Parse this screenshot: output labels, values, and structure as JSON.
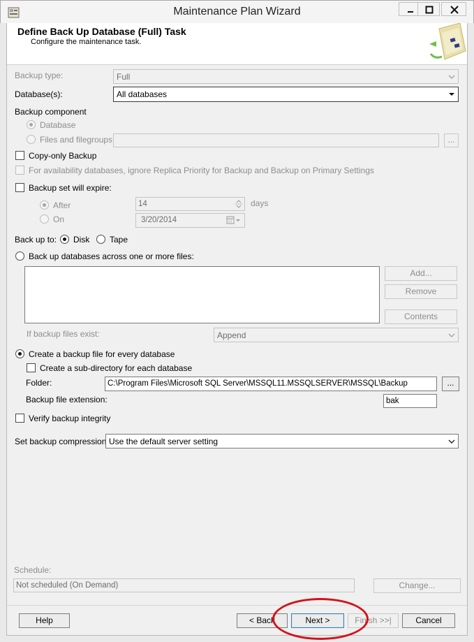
{
  "window": {
    "title": "Maintenance Plan Wizard"
  },
  "header": {
    "title": "Define Back Up Database (Full) Task",
    "subtitle": "Configure the maintenance task."
  },
  "form": {
    "backup_type": {
      "label": "Backup type:",
      "value": "Full"
    },
    "databases": {
      "label": "Database(s):",
      "value": "All databases"
    },
    "backup_component": {
      "label": "Backup component",
      "database_label": "Database",
      "files_label": "Files and filegroups:",
      "files_button": "...",
      "selected": "Database"
    },
    "copy_only": {
      "label": "Copy-only Backup",
      "checked": false
    },
    "availability": {
      "label": "For availability databases, ignore Replica Priority for Backup and Backup on Primary Settings",
      "checked": false
    },
    "expire": {
      "label": "Backup set will expire:",
      "checked": false,
      "after_label": "After",
      "after_value": "14",
      "days_label": "days",
      "on_label": "On",
      "on_value": "3/20/2014",
      "selected": "After"
    },
    "back_up_to": {
      "label": "Back up to:",
      "disk_label": "Disk",
      "tape_label": "Tape",
      "selected": "Disk"
    },
    "across_files": {
      "label": "Back up databases across one or more files:",
      "add_button": "Add...",
      "remove_button": "Remove",
      "contents_button": "Contents",
      "exists_label": "If backup files exist:",
      "exists_value": "Append"
    },
    "every_db": {
      "label": "Create a backup file for every database",
      "subdir_label": "Create a sub-directory for each database",
      "subdir_checked": false,
      "folder_label": "Folder:",
      "folder_value": "C:\\Program Files\\Microsoft SQL Server\\MSSQL11.MSSQLSERVER\\MSSQL\\Backup",
      "folder_button": "...",
      "ext_label": "Backup file extension:",
      "ext_value": "bak"
    },
    "verify": {
      "label": "Verify backup integrity",
      "checked": false
    },
    "compression": {
      "label": "Set backup compression:",
      "value": "Use the default server setting"
    },
    "schedule": {
      "label": "Schedule:",
      "value": "Not scheduled (On Demand)",
      "change_button": "Change..."
    }
  },
  "footer": {
    "help": "Help",
    "back": "< Back",
    "next": "Next >",
    "finish": "Finish >>|",
    "cancel": "Cancel"
  },
  "colors": {
    "annotation": "#d3121b",
    "disabled_text": "#8d8d8d"
  },
  "icons": [
    "app-icon",
    "minimize-icon",
    "maximize-icon",
    "close-icon",
    "wizard-art-icon",
    "dropdown-arrow-icon",
    "spin-icon",
    "calendar-icon"
  ]
}
